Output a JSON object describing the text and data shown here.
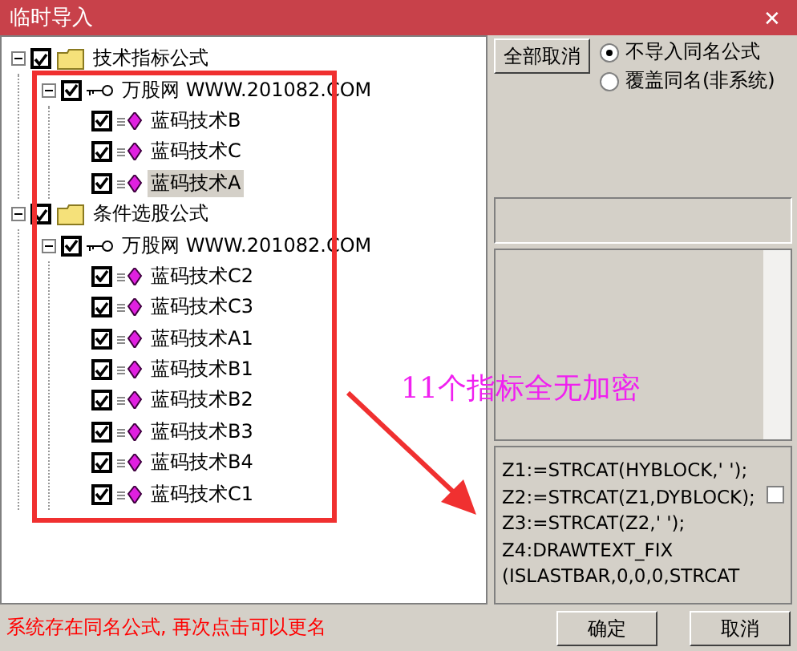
{
  "window": {
    "title": "临时导入",
    "close": "✕"
  },
  "tree": [
    {
      "label": "技术指标公式",
      "kind": "folder",
      "checked": true,
      "expanded": true,
      "selected": false,
      "children": [
        {
          "label": "万股网 WWW.201082.COM",
          "kind": "group",
          "checked": true,
          "expanded": true,
          "selected": false,
          "children": [
            {
              "label": "蓝码技术B",
              "kind": "formula",
              "checked": true,
              "selected": false
            },
            {
              "label": "蓝码技术C",
              "kind": "formula",
              "checked": true,
              "selected": false
            },
            {
              "label": "蓝码技术A",
              "kind": "formula",
              "checked": true,
              "selected": true
            }
          ]
        }
      ]
    },
    {
      "label": "条件选股公式",
      "kind": "folder",
      "checked": true,
      "expanded": true,
      "selected": false,
      "children": [
        {
          "label": "万股网 WWW.201082.COM",
          "kind": "group",
          "checked": true,
          "expanded": true,
          "selected": false,
          "children": [
            {
              "label": "蓝码技术C2",
              "kind": "formula",
              "checked": true,
              "selected": false
            },
            {
              "label": "蓝码技术C3",
              "kind": "formula",
              "checked": true,
              "selected": false
            },
            {
              "label": "蓝码技术A1",
              "kind": "formula",
              "checked": true,
              "selected": false
            },
            {
              "label": "蓝码技术B1",
              "kind": "formula",
              "checked": true,
              "selected": false
            },
            {
              "label": "蓝码技术B2",
              "kind": "formula",
              "checked": true,
              "selected": false
            },
            {
              "label": "蓝码技术B3",
              "kind": "formula",
              "checked": true,
              "selected": false
            },
            {
              "label": "蓝码技术B4",
              "kind": "formula",
              "checked": true,
              "selected": false
            },
            {
              "label": "蓝码技术C1",
              "kind": "formula",
              "checked": true,
              "selected": false
            }
          ]
        }
      ]
    }
  ],
  "cancel_all_button": "全部取消",
  "radios": [
    {
      "label": "不导入同名公式",
      "selected": true
    },
    {
      "label": "覆盖同名(非系统)",
      "selected": false
    }
  ],
  "code_lines": [
    "Z1:=STRCAT(HYBLOCK,' ');",
    "Z2:=STRCAT(Z1,DYBLOCK);",
    "Z3:=STRCAT(Z2,' ');",
    "Z4:DRAWTEXT_FIX",
    "(ISLASTBAR,0,0,0,STRCAT"
  ],
  "code_checkbox": {
    "checked": false
  },
  "status": "系统存在同名公式, 再次点击可以更名",
  "buttons": [
    "确定",
    "取消"
  ],
  "annotation": {
    "text": "11个指标全无加密"
  }
}
